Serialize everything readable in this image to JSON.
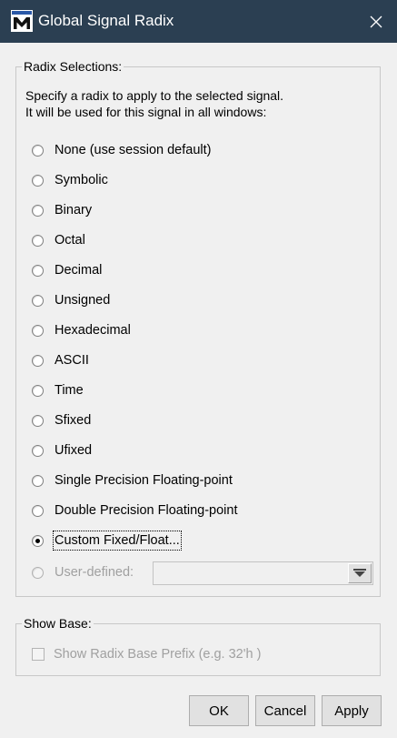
{
  "window": {
    "title": "Global Signal Radix",
    "close_glyph": "✕"
  },
  "radix_group": {
    "legend": "Radix Selections:",
    "description_line1": "Specify a radix to apply to the selected signal.",
    "description_line2": "It will be used for this signal in all windows:",
    "options": [
      {
        "label": "None (use session default)",
        "checked": false
      },
      {
        "label": "Symbolic",
        "checked": false
      },
      {
        "label": "Binary",
        "checked": false
      },
      {
        "label": "Octal",
        "checked": false
      },
      {
        "label": "Decimal",
        "checked": false
      },
      {
        "label": "Unsigned",
        "checked": false
      },
      {
        "label": "Hexadecimal",
        "checked": false
      },
      {
        "label": "ASCII",
        "checked": false
      },
      {
        "label": "Time",
        "checked": false
      },
      {
        "label": "Sfixed",
        "checked": false
      },
      {
        "label": "Ufixed",
        "checked": false
      },
      {
        "label": "Single Precision Floating-point",
        "checked": false
      },
      {
        "label": "Double Precision Floating-point",
        "checked": false
      },
      {
        "label": "Custom Fixed/Float...",
        "checked": true
      }
    ],
    "user_defined": {
      "label": "User-defined:",
      "value": "",
      "disabled": true
    }
  },
  "show_base_group": {
    "legend": "Show Base:",
    "checkbox_label": "Show Radix Base Prefix (e.g. 32'h )",
    "checked": false,
    "disabled": true
  },
  "buttons": {
    "ok": "OK",
    "cancel": "Cancel",
    "apply": "Apply"
  },
  "colors": {
    "titlebar": "#2b3f52",
    "dialog_bg": "#f0f0f0",
    "disabled_text": "#a0a0a0"
  },
  "icons": {
    "app": "modelsim-logo-icon",
    "close": "close-icon",
    "dropdown": "dropdown-arrow-icon"
  }
}
